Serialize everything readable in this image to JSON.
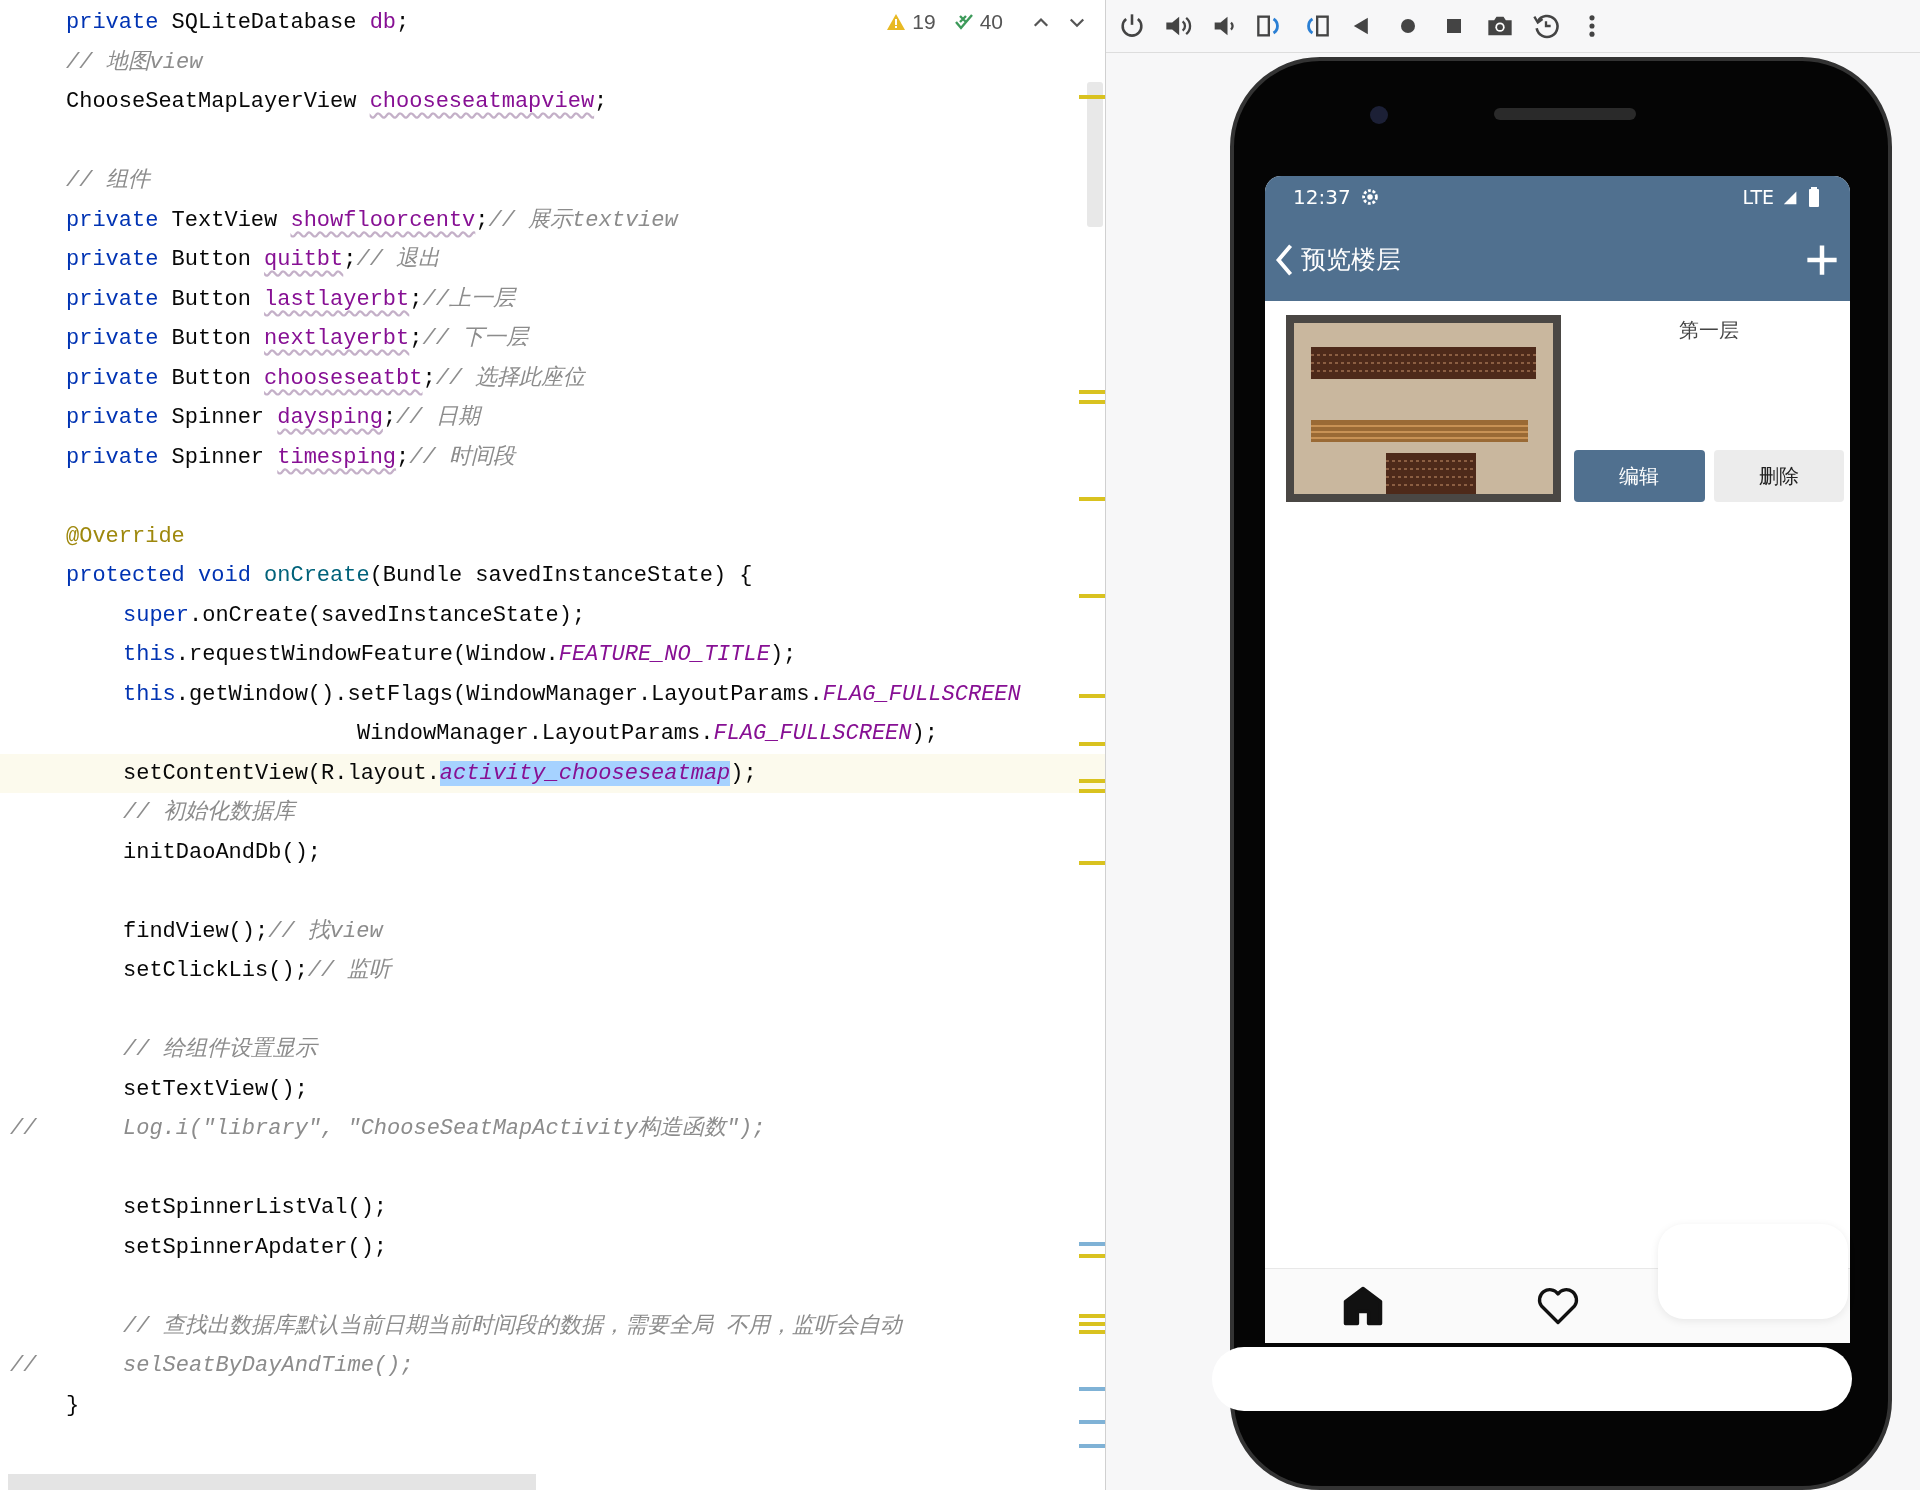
{
  "editor": {
    "inspections": {
      "warnings": "19",
      "passed": "40"
    },
    "lines": [
      {
        "kind": "code",
        "indented": false,
        "current": false,
        "tokens": [
          {
            "kind": "kw",
            "text": "private"
          },
          {
            "kind": "plain",
            "text": " SQLiteDatabase "
          },
          {
            "kind": "field",
            "text": "db"
          },
          {
            "kind": "plain",
            "text": ";"
          }
        ]
      },
      {
        "kind": "code",
        "indented": false,
        "current": false,
        "tokens": [
          {
            "kind": "comment",
            "text": "// 地图view"
          }
        ]
      },
      {
        "kind": "code",
        "indented": false,
        "current": false,
        "tokens": [
          {
            "kind": "plain",
            "text": "ChooseSeatMapLayerView "
          },
          {
            "kind": "unused",
            "text": "chooseseatmapview"
          },
          {
            "kind": "plain",
            "text": ";"
          }
        ]
      },
      {
        "kind": "blank"
      },
      {
        "kind": "code",
        "indented": false,
        "current": false,
        "tokens": [
          {
            "kind": "comment",
            "text": "// 组件"
          }
        ]
      },
      {
        "kind": "code",
        "indented": false,
        "current": false,
        "tokens": [
          {
            "kind": "kw",
            "text": "private"
          },
          {
            "kind": "plain",
            "text": " TextView "
          },
          {
            "kind": "unused",
            "text": "showfloorcentv"
          },
          {
            "kind": "plain",
            "text": ";"
          },
          {
            "kind": "comment",
            "text": "// 展示textview"
          }
        ]
      },
      {
        "kind": "code",
        "indented": false,
        "current": false,
        "tokens": [
          {
            "kind": "kw",
            "text": "private"
          },
          {
            "kind": "plain",
            "text": " Button "
          },
          {
            "kind": "unused",
            "text": "quitbt"
          },
          {
            "kind": "plain",
            "text": ";"
          },
          {
            "kind": "comment",
            "text": "// 退出"
          }
        ]
      },
      {
        "kind": "code",
        "indented": false,
        "current": false,
        "tokens": [
          {
            "kind": "kw",
            "text": "private"
          },
          {
            "kind": "plain",
            "text": " Button "
          },
          {
            "kind": "unused",
            "text": "lastlayerbt"
          },
          {
            "kind": "plain",
            "text": ";"
          },
          {
            "kind": "comment",
            "text": "//上一层"
          }
        ]
      },
      {
        "kind": "code",
        "indented": false,
        "current": false,
        "tokens": [
          {
            "kind": "kw",
            "text": "private"
          },
          {
            "kind": "plain",
            "text": " Button "
          },
          {
            "kind": "unused",
            "text": "nextlayerbt"
          },
          {
            "kind": "plain",
            "text": ";"
          },
          {
            "kind": "comment",
            "text": "// 下一层"
          }
        ]
      },
      {
        "kind": "code",
        "indented": false,
        "current": false,
        "tokens": [
          {
            "kind": "kw",
            "text": "private"
          },
          {
            "kind": "plain",
            "text": " Button "
          },
          {
            "kind": "unused",
            "text": "chooseseatbt"
          },
          {
            "kind": "plain",
            "text": ";"
          },
          {
            "kind": "comment",
            "text": "// 选择此座位"
          }
        ]
      },
      {
        "kind": "code",
        "indented": false,
        "current": false,
        "tokens": [
          {
            "kind": "kw",
            "text": "private"
          },
          {
            "kind": "plain",
            "text": " Spinner "
          },
          {
            "kind": "unused",
            "text": "daysping"
          },
          {
            "kind": "plain",
            "text": ";"
          },
          {
            "kind": "comment",
            "text": "// 日期"
          }
        ]
      },
      {
        "kind": "code",
        "indented": false,
        "current": false,
        "tokens": [
          {
            "kind": "kw",
            "text": "private"
          },
          {
            "kind": "plain",
            "text": " Spinner "
          },
          {
            "kind": "unused",
            "text": "timesping"
          },
          {
            "kind": "plain",
            "text": ";"
          },
          {
            "kind": "comment",
            "text": "// 时间段"
          }
        ]
      },
      {
        "kind": "blank"
      },
      {
        "kind": "code",
        "indented": false,
        "current": false,
        "tokens": [
          {
            "kind": "annotation",
            "text": "@Override"
          }
        ]
      },
      {
        "kind": "code",
        "indented": false,
        "current": false,
        "tokens": [
          {
            "kind": "kw",
            "text": "protected void "
          },
          {
            "kind": "method",
            "text": "onCreate"
          },
          {
            "kind": "plain",
            "text": "(Bundle savedInstanceState) {"
          }
        ]
      },
      {
        "kind": "code",
        "indented": true,
        "current": false,
        "tokens": [
          {
            "kind": "kw",
            "text": "super"
          },
          {
            "kind": "plain",
            "text": ".onCreate(savedInstanceState);"
          }
        ]
      },
      {
        "kind": "code",
        "indented": true,
        "current": false,
        "tokens": [
          {
            "kind": "kw",
            "text": "this"
          },
          {
            "kind": "plain",
            "text": ".requestWindowFeature(Window."
          },
          {
            "kind": "constant",
            "text": "FEATURE_NO_TITLE"
          },
          {
            "kind": "plain",
            "text": ");"
          }
        ]
      },
      {
        "kind": "code",
        "indented": true,
        "current": false,
        "tokens": [
          {
            "kind": "kw",
            "text": "this"
          },
          {
            "kind": "plain",
            "text": ".getWindow().setFlags(WindowManager.LayoutParams."
          },
          {
            "kind": "constant",
            "text": "FLAG_FULLSCREEN"
          }
        ]
      },
      {
        "kind": "continuation",
        "current": false,
        "tokens": [
          {
            "kind": "plain",
            "text": "WindowManager.LayoutParams."
          },
          {
            "kind": "constant",
            "text": "FLAG_FULLSCREEN"
          },
          {
            "kind": "plain",
            "text": ");"
          }
        ]
      },
      {
        "kind": "code",
        "indented": true,
        "current": true,
        "tokens": [
          {
            "kind": "plain",
            "text": "setContentView(R.layout."
          },
          {
            "kind": "selected",
            "text": "activity_chooseseatmap"
          },
          {
            "kind": "plain",
            "text": ");"
          }
        ]
      },
      {
        "kind": "code",
        "indented": true,
        "current": false,
        "tokens": [
          {
            "kind": "comment",
            "text": "// 初始化数据库"
          }
        ]
      },
      {
        "kind": "code",
        "indented": true,
        "current": false,
        "tokens": [
          {
            "kind": "plain",
            "text": "initDaoAndDb();"
          }
        ]
      },
      {
        "kind": "blank"
      },
      {
        "kind": "code",
        "indented": true,
        "current": false,
        "tokens": [
          {
            "kind": "plain",
            "text": "findView();"
          },
          {
            "kind": "comment",
            "text": "// 找view"
          }
        ]
      },
      {
        "kind": "code",
        "indented": true,
        "current": false,
        "tokens": [
          {
            "kind": "plain",
            "text": "setClickLis();"
          },
          {
            "kind": "comment",
            "text": "// 监听"
          }
        ]
      },
      {
        "kind": "blank"
      },
      {
        "kind": "code",
        "indented": true,
        "current": false,
        "tokens": [
          {
            "kind": "comment",
            "text": "// 给组件设置显示"
          }
        ]
      },
      {
        "kind": "code",
        "indented": true,
        "current": false,
        "tokens": [
          {
            "kind": "plain",
            "text": "setTextView();"
          }
        ]
      },
      {
        "kind": "code",
        "indented": true,
        "current": false,
        "gutter": "//",
        "tokens": [
          {
            "kind": "comment",
            "text": "Log.i(\"library\", \"ChooseSeatMapActivity构造函数\");"
          }
        ]
      },
      {
        "kind": "blank"
      },
      {
        "kind": "code",
        "indented": true,
        "current": false,
        "tokens": [
          {
            "kind": "plain",
            "text": "setSpinnerListVal();"
          }
        ]
      },
      {
        "kind": "code",
        "indented": true,
        "current": false,
        "tokens": [
          {
            "kind": "plain",
            "text": "setSpinnerApdater();"
          }
        ]
      },
      {
        "kind": "blank"
      },
      {
        "kind": "code",
        "indented": true,
        "current": false,
        "tokens": [
          {
            "kind": "comment",
            "text": "// 查找出数据库默认当前日期当前时间段的数据，需要全局 不用，监听会自动"
          }
        ]
      },
      {
        "kind": "code",
        "indented": true,
        "current": false,
        "gutter": "//",
        "tokens": [
          {
            "kind": "comment",
            "text": "selSeatByDayAndTime();"
          }
        ]
      },
      {
        "kind": "code",
        "indented": false,
        "current": false,
        "tokens": [
          {
            "kind": "plain",
            "text": "}"
          }
        ]
      }
    ]
  },
  "emulator": {
    "phone": {
      "status_bar": {
        "time": "12:37",
        "network": "LTE"
      },
      "app_bar": {
        "title": "预览楼层"
      },
      "floors": [
        {
          "name": "第一层",
          "buttons": [
            {
              "label": "编辑",
              "primary": true
            },
            {
              "label": "删除",
              "primary": false
            }
          ]
        }
      ],
      "nav": [
        {
          "selected": true
        },
        {
          "selected": false
        }
      ]
    }
  }
}
